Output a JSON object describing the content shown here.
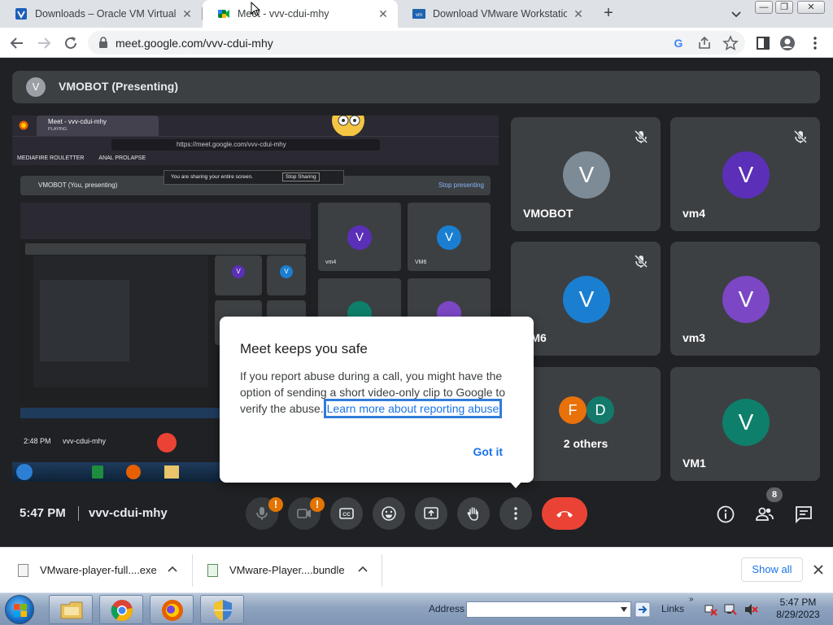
{
  "browser": {
    "tabs": [
      {
        "title": "Downloads – Oracle VM VirtualB",
        "favicon": "virtualbox-icon",
        "active": false
      },
      {
        "title": "Meet - vvv-cdui-mhy",
        "favicon": "google-meet-icon",
        "active": true
      },
      {
        "title": "Download VMware Workstation",
        "favicon": "vmware-icon",
        "active": false
      }
    ],
    "url": "meet.google.com/vvv-cdui-mhy"
  },
  "meet": {
    "presenter_initial": "V",
    "presenter_label": "VMOBOT (Presenting)",
    "shared_screen": {
      "tab_title": "Meet - vvv-cdui-mhy",
      "tab_sub": "PLAYING",
      "url": "https://meet.google.com/vvv-cdui-mhy",
      "bookmarks": [
        "MEDIAFIRE ROULETTER",
        "ANAL PROLAPSE"
      ],
      "presenting_label": "VMOBOT (You, presenting)",
      "stop_presenting": "Stop presenting",
      "sharing_notice": "You are sharing your entire screen.",
      "stop_sharing": "Stop Sharing",
      "tiles": [
        {
          "name": "vm4",
          "initial": "V",
          "color": "#5b2fb8"
        },
        {
          "name": "VM6",
          "initial": "V",
          "color": "#1a7fd1"
        }
      ],
      "time": "2:48 PM",
      "code": "vvv-cdui-mhy"
    },
    "participants": [
      {
        "name": "VMOBOT",
        "initial": "V",
        "color": "#7d8b96",
        "muted": true
      },
      {
        "name": "vm4",
        "initial": "V",
        "color": "#5b2fb8",
        "muted": true
      },
      {
        "name": "VM6",
        "initial": "V",
        "color": "#1a7fd1",
        "muted": true
      },
      {
        "name": "vm3",
        "initial": "V",
        "color": "#7b47c4",
        "muted": false
      },
      {
        "name": "2 others",
        "initials": [
          "F",
          "D"
        ],
        "colors": [
          "#e8710a",
          "#137a6b"
        ],
        "muted": false
      },
      {
        "name": "VM1",
        "initial": "V",
        "color": "#0e7f6a",
        "muted": false
      }
    ],
    "dialog": {
      "title": "Meet keeps you safe",
      "body": "If you report abuse during a call, you might have the option of sending a short video-only clip to Google to verify the abuse.",
      "link": "Learn more about reporting abuse",
      "button": "Got it"
    },
    "controls": {
      "time": "5:47 PM",
      "meeting_code": "vvv-cdui-mhy",
      "warning_badge": "!",
      "people_count": "8"
    }
  },
  "downloads": {
    "items": [
      {
        "name": "VMware-player-full....exe"
      },
      {
        "name": "VMware-Player....bundle"
      }
    ],
    "show_all": "Show all"
  },
  "taskbar": {
    "address_label": "Address",
    "links_label": "Links",
    "time": "5:47 PM",
    "date": "8/29/2023"
  }
}
